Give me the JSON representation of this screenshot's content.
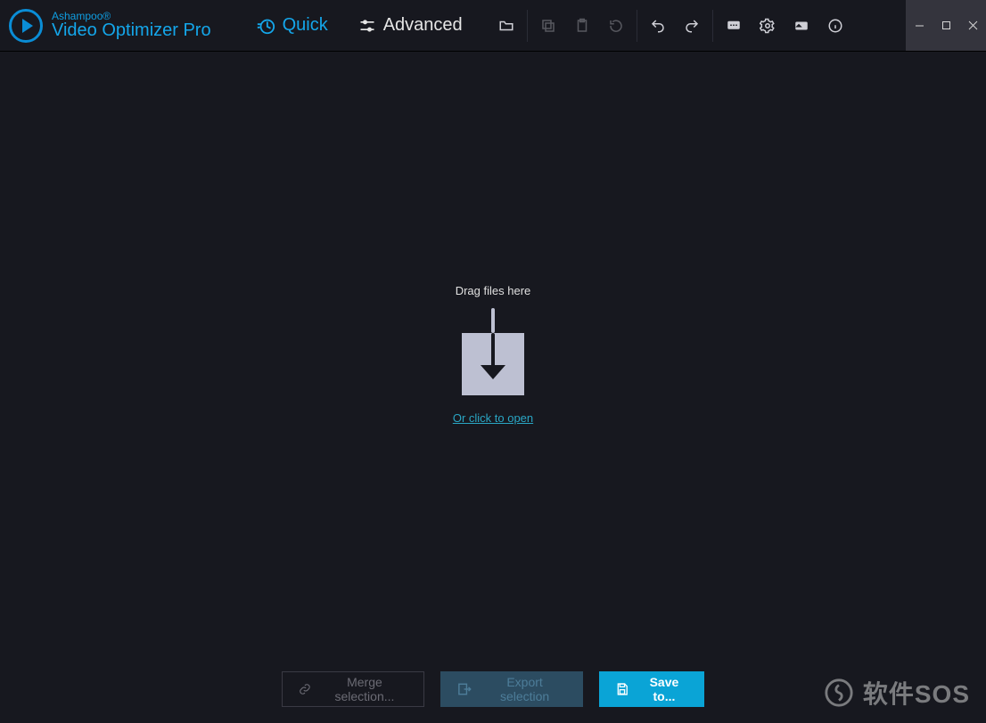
{
  "brand": {
    "top": "Ashampoo®",
    "bottom": "Video Optimizer Pro"
  },
  "modes": {
    "quick": "Quick",
    "advanced": "Advanced"
  },
  "icons": {
    "folder": "folder",
    "copy": "copy",
    "paste": "paste",
    "reset": "reset",
    "undo": "undo",
    "redo": "redo",
    "feedback": "feedback",
    "settings": "settings",
    "card": "card",
    "info": "info"
  },
  "dropzone": {
    "drag_text": "Drag files here",
    "open_link": "Or click to open"
  },
  "buttons": {
    "merge": "Merge selection...",
    "export": "Export selection",
    "save": "Save to..."
  },
  "watermark": {
    "text": "软件SOS"
  }
}
